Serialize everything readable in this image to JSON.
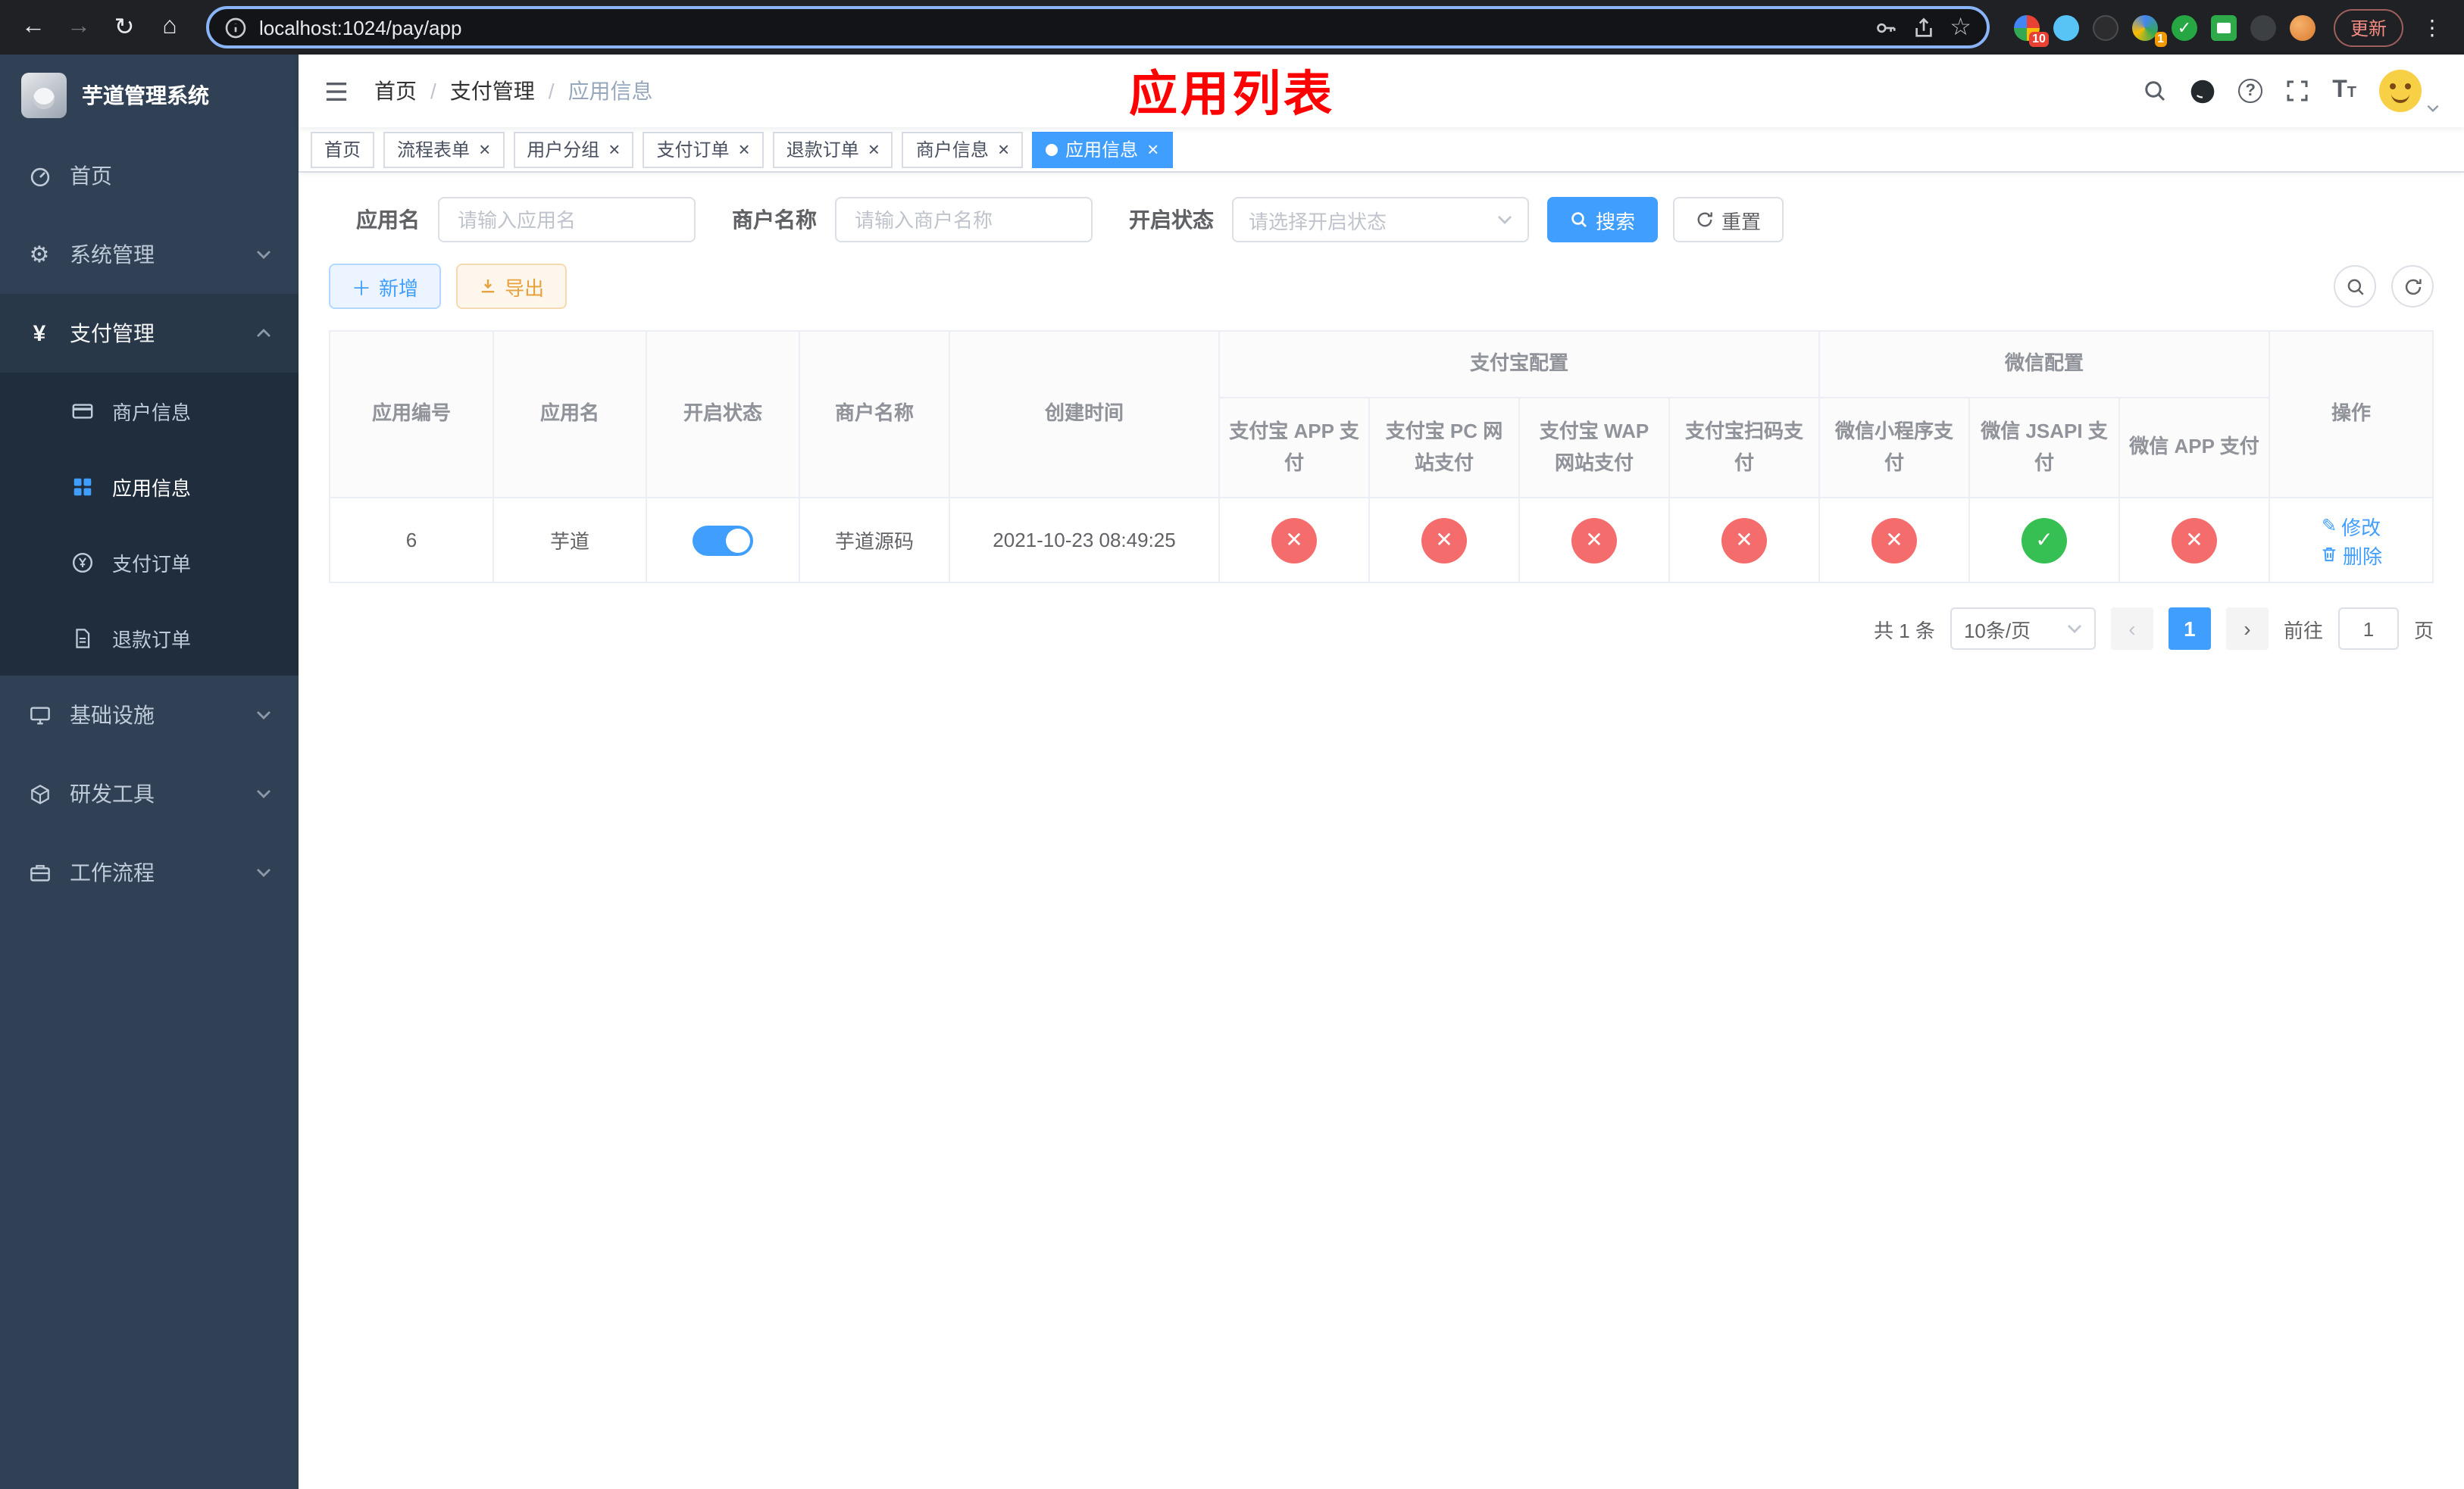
{
  "colors": {
    "primary": "#409EFF",
    "danger": "#f56c6c",
    "success": "#36c054",
    "title_red": "#ff0000",
    "sidebar_bg": "#304156",
    "submenu_bg": "#1f2d3d"
  },
  "browser": {
    "url": "localhost:1024/pay/app",
    "update_label": "更新",
    "ext_badge_1": "10",
    "ext_badge_2": "1"
  },
  "sidebar": {
    "app_title": "芋道管理系统",
    "home": "首页",
    "system": "系统管理",
    "payment": "支付管理",
    "merchant_info": "商户信息",
    "app_info": "应用信息",
    "pay_order": "支付订单",
    "refund_order": "退款订单",
    "infrastructure": "基础设施",
    "dev_tools": "研发工具",
    "workflow": "工作流程"
  },
  "header": {
    "breadcrumb": [
      "首页",
      "支付管理",
      "应用信息"
    ],
    "separator": "/",
    "title": "应用列表"
  },
  "tabs": [
    {
      "label": "首页"
    },
    {
      "label": "流程表单"
    },
    {
      "label": "用户分组"
    },
    {
      "label": "支付订单"
    },
    {
      "label": "退款订单"
    },
    {
      "label": "商户信息"
    },
    {
      "label": "应用信息"
    }
  ],
  "filters": {
    "app_name_label": "应用名",
    "app_name_placeholder": "请输入应用名",
    "merchant_label": "商户名称",
    "merchant_placeholder": "请输入商户名称",
    "status_label": "开启状态",
    "status_placeholder": "请选择开启状态",
    "search_label": "搜索",
    "reset_label": "重置"
  },
  "toolbar": {
    "add_label": "新增",
    "export_label": "导出"
  },
  "table": {
    "col_id": "应用编号",
    "col_name": "应用名",
    "col_status": "开启状态",
    "col_merchant": "商户名称",
    "col_created": "创建时间",
    "col_actions": "操作",
    "group_alipay": "支付宝配置",
    "group_wechat": "微信配置",
    "sub_columns": [
      "支付宝 APP 支付",
      "支付宝 PC 网站支付",
      "支付宝 WAP 网站支付",
      "支付宝扫码支付",
      "微信小程序支付",
      "微信 JSAPI 支付",
      "微信 APP 支付"
    ],
    "rows": [
      {
        "id": "6",
        "name": "芋道",
        "enabled": true,
        "merchant": "芋道源码",
        "created": "2021-10-23 08:49:25",
        "configs": [
          false,
          false,
          false,
          false,
          false,
          true,
          false
        ],
        "edit_label": "修改",
        "delete_label": "删除"
      }
    ]
  },
  "pagination": {
    "total": "共 1 条",
    "page_size": "10条/页",
    "page": "1",
    "goto_prefix": "前往",
    "goto_value": "1",
    "goto_suffix": "页"
  }
}
